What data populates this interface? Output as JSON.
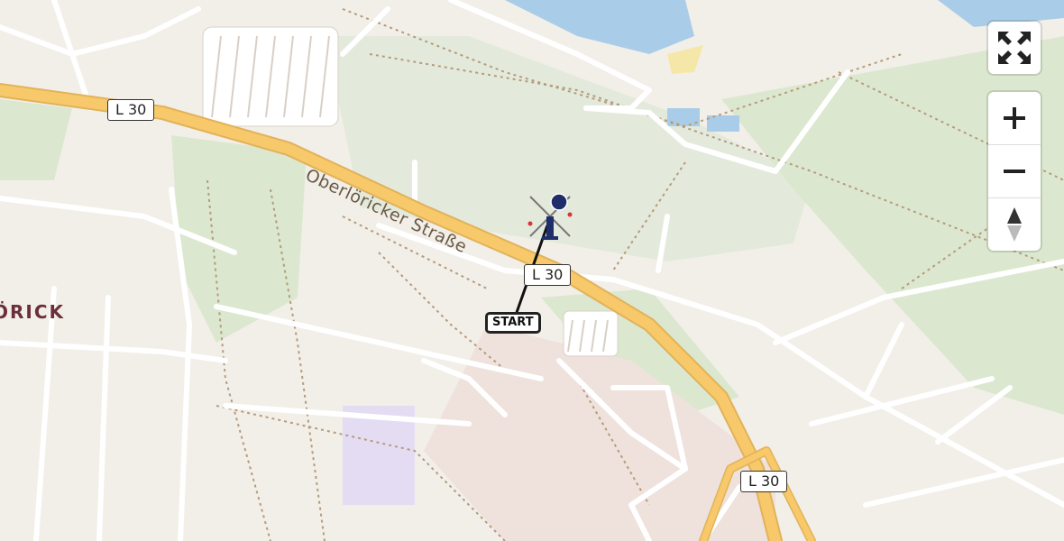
{
  "map": {
    "road_labels": [
      "L 30",
      "L 30",
      "L 30"
    ],
    "street_name": "Oberlöricker Straße",
    "district_label": "ÖRICK",
    "start_label": "START"
  },
  "controls": {
    "fullscreen_icon": "fullscreen-icon",
    "zoom_in_icon": "plus-icon",
    "zoom_out_icon": "minus-icon",
    "compass_icon": "compass-icon"
  },
  "colors": {
    "road_major": "#f7c96a",
    "green": "#dfe9d3",
    "water": "#a9cde8",
    "route": "#111111",
    "helicopter": "#1f2d6b"
  }
}
